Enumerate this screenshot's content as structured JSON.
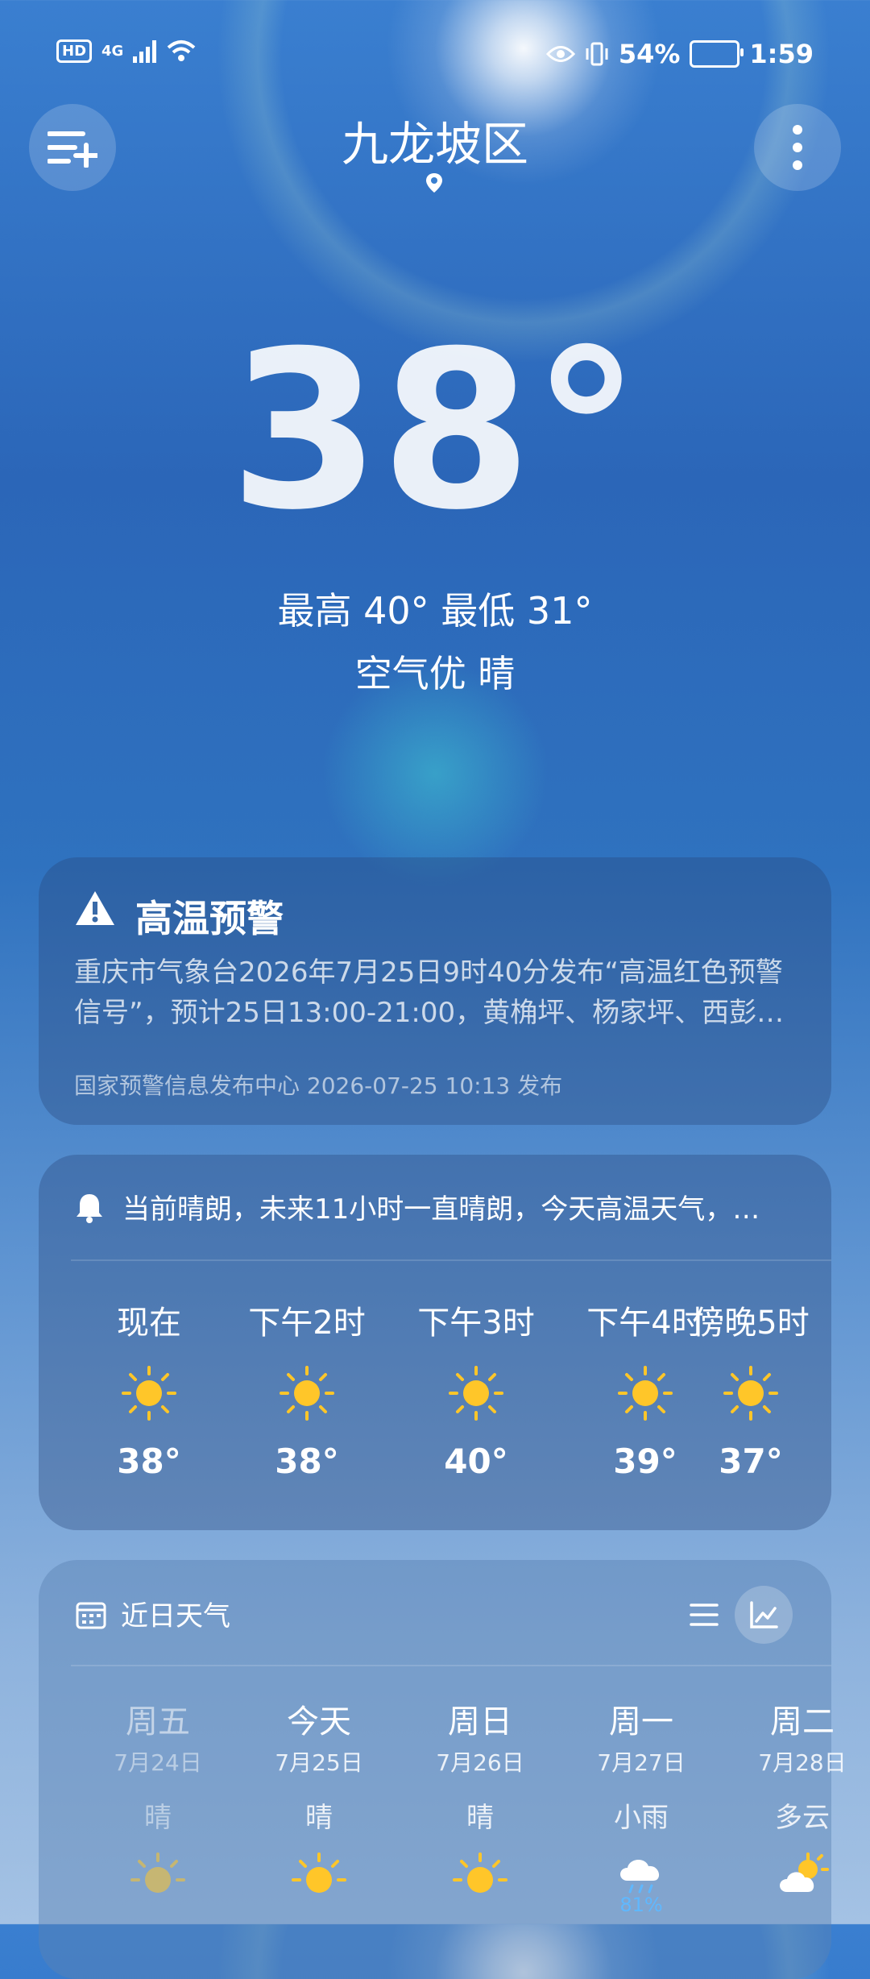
{
  "status_bar": {
    "hd": "HD",
    "network": "4G",
    "battery": "54%",
    "time": "1:59"
  },
  "location": {
    "city": "九龙坡区"
  },
  "current": {
    "temperature": "38°",
    "hi_lo": "最高 40° 最低 31°",
    "air_weather": "空气优  晴"
  },
  "alert": {
    "title": "高温预警",
    "line1": "重庆市气象台2026年7月25日9时40分发布“高温红色预警",
    "line2": "信号”，预计25日13:00-21:00，黄桷坪、杨家坪、西彭…",
    "source": "国家预警信息发布中心 2026-07-25 10:13 发布"
  },
  "hourly": {
    "summary": "当前晴朗，未来11小时一直晴朗，今天高温天气，…",
    "items": [
      {
        "time": "现在",
        "icon": "sun-icon",
        "temp": "38°"
      },
      {
        "time": "下午2时",
        "icon": "sun-icon",
        "temp": "38°"
      },
      {
        "time": "下午3时",
        "icon": "sun-icon",
        "temp": "40°"
      },
      {
        "time": "下午4时",
        "icon": "sun-icon",
        "temp": "39°"
      },
      {
        "time": "傍晚5时",
        "icon": "sun-icon",
        "temp": "37°"
      }
    ]
  },
  "daily": {
    "heading": "近日天气",
    "items": [
      {
        "weekday": "周五",
        "date": "7月24日",
        "cond": "晴",
        "icon": "sun-icon"
      },
      {
        "weekday": "今天",
        "date": "7月25日",
        "cond": "晴",
        "icon": "sun-icon"
      },
      {
        "weekday": "周日",
        "date": "7月26日",
        "cond": "晴",
        "icon": "sun-icon"
      },
      {
        "weekday": "周一",
        "date": "7月27日",
        "cond": "小雨",
        "icon": "rain-cloud-icon",
        "precip": "81%"
      },
      {
        "weekday": "周二",
        "date": "7月28日",
        "cond": "多云",
        "icon": "partly-cloudy-icon"
      }
    ]
  },
  "colors": {
    "sun": "#ffc629",
    "precip": "#5fb8ff"
  }
}
